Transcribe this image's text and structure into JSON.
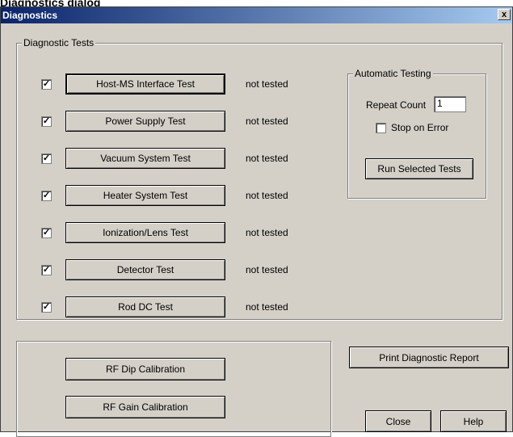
{
  "top_fragment": "Diagnostics dialog",
  "window": {
    "title": "Diagnostics",
    "close_glyph": "x"
  },
  "diagnostic_tests": {
    "legend": "Diagnostic Tests",
    "tests": [
      {
        "label": "Host-MS Interface Test",
        "status": "not tested",
        "checked": true
      },
      {
        "label": "Power Supply Test",
        "status": "not tested",
        "checked": true
      },
      {
        "label": "Vacuum System Test",
        "status": "not tested",
        "checked": true
      },
      {
        "label": "Heater System Test",
        "status": "not tested",
        "checked": true
      },
      {
        "label": "Ionization/Lens Test",
        "status": "not tested",
        "checked": true
      },
      {
        "label": "Detector Test",
        "status": "not tested",
        "checked": true
      },
      {
        "label": "Rod DC Test",
        "status": "not tested",
        "checked": true
      }
    ],
    "check_glyph": "✓"
  },
  "automatic_testing": {
    "legend": "Automatic Testing",
    "repeat_count_label": "Repeat Count",
    "repeat_count_value": "1",
    "stop_on_error_label": "Stop on Error",
    "stop_on_error_checked": false,
    "run_button": "Run Selected Tests"
  },
  "calibration": {
    "rf_dip_button": "RF Dip Calibration",
    "rf_gain_button": "RF Gain Calibration"
  },
  "footer": {
    "print_report_button": "Print Diagnostic Report",
    "close_button": "Close",
    "help_button": "Help"
  }
}
